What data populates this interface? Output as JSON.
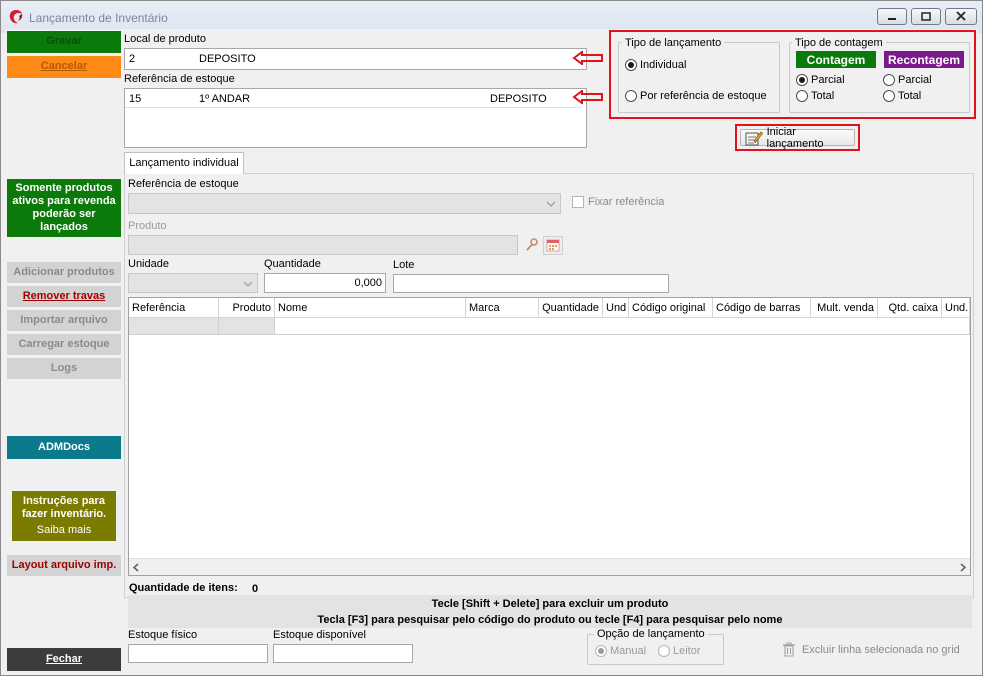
{
  "window": {
    "title": "Lançamento de Inventário"
  },
  "sidebar": {
    "gravar": "Gravar",
    "cancelar": "Cancelar",
    "info_ativos": "Somente produtos ativos para revenda poderão ser lançados",
    "adicionar": "Adicionar produtos",
    "remover": "Remover travas",
    "importar": "Importar arquivo",
    "carregar": "Carregar estoque",
    "logs": "Logs",
    "admdocs": "ADMDocs",
    "instrucoes_title": "Instruções para fazer inventário.",
    "instrucoes_link": "Saiba mais",
    "layout": "Layout arquivo imp.",
    "fechar": "Fechar"
  },
  "local": {
    "label": "Local de produto",
    "code": "2",
    "name": "DEPOSITO"
  },
  "referencia": {
    "label": "Referência de estoque",
    "code": "15",
    "name": "1º ANDAR",
    "local": "DEPOSITO"
  },
  "tipo_lancamento": {
    "title": "Tipo de lançamento",
    "opt_individual": "Individual",
    "opt_referencia": "Por referência de estoque"
  },
  "tipo_contagem": {
    "title": "Tipo de contagem",
    "contagem": "Contagem",
    "recontagem": "Recontagem",
    "parcial": "Parcial",
    "total": "Total"
  },
  "iniciar": "Iniciar lançamento",
  "tab": {
    "label": "Lançamento individual"
  },
  "form": {
    "ref_label": "Referência de estoque",
    "fixar": "Fixar referência",
    "produto_label": "Produto",
    "unidade_label": "Unidade",
    "quantidade_label": "Quantidade",
    "quantidade_value": "0,000",
    "lote_label": "Lote"
  },
  "grid": {
    "columns": [
      "Referência",
      "Produto",
      "Nome",
      "Marca",
      "Quantidade",
      "Und",
      "Código original",
      "Código de barras",
      "Mult. venda",
      "Qtd. caixa",
      "Und."
    ]
  },
  "footer": {
    "qtd_label": "Quantidade de itens:",
    "qtd_value": "0",
    "hint1": "Tecle [Shift + Delete] para excluir um produto",
    "hint2": "Tecla [F3] para pesquisar pelo código do produto ou tecle [F4] para pesquisar pelo nome",
    "estoque_fisico": "Estoque físico",
    "estoque_disponivel": "Estoque disponível",
    "opcao_title": "Opção de lançamento",
    "manual": "Manual",
    "leitor": "Leitor",
    "excluir": "Excluir linha selecionada no grid"
  },
  "colors": {
    "accent_red": "#e0121c",
    "green": "#0b7a0b",
    "purple": "#7b1a8a",
    "orange": "#ff8a17",
    "teal": "#0b7a8a",
    "olive": "#7b7b00"
  }
}
